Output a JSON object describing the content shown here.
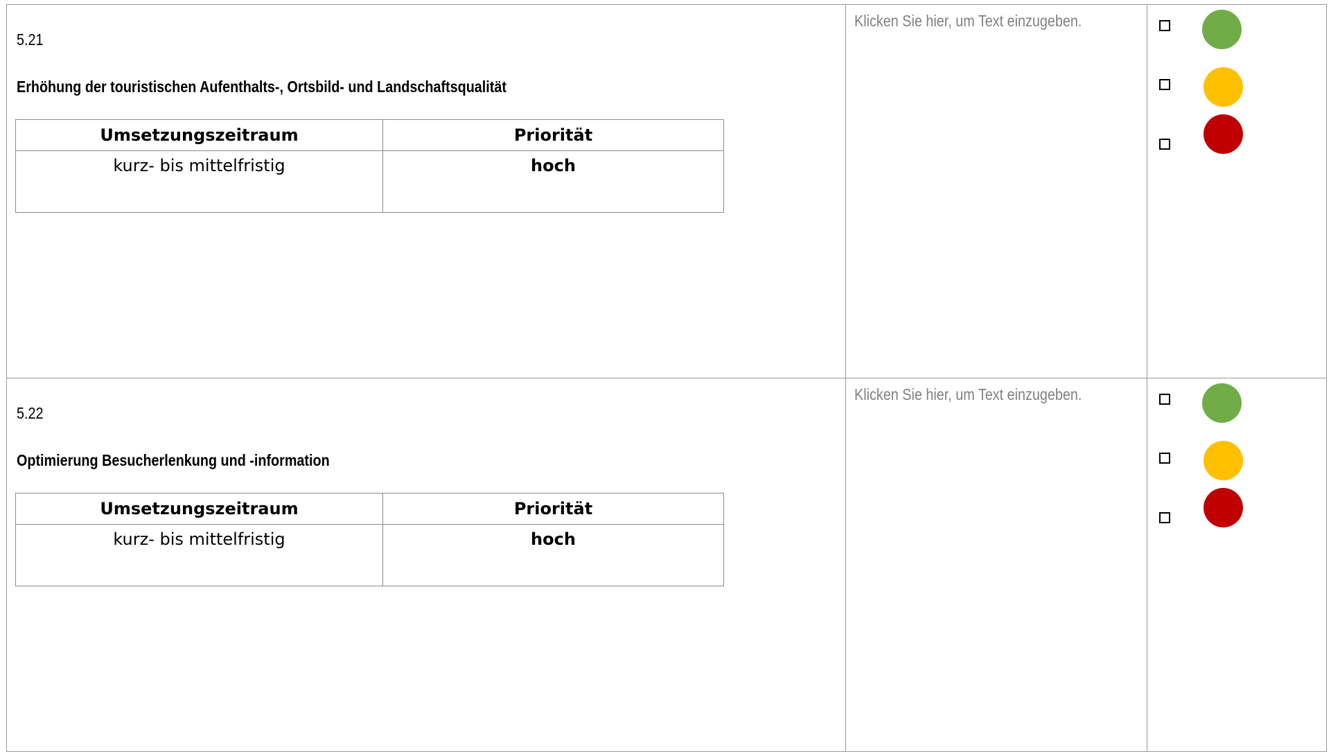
{
  "measures": [
    {
      "id": "5.21",
      "title": "Erhöhung der touristischen Aufenthalts-, Ortsbild- und Landschaftsqualität",
      "table": {
        "headers": [
          "Umsetzungszeitraum",
          "Priorität"
        ],
        "row": [
          "kurz- bis mittelfristig",
          "hoch"
        ]
      },
      "comment_placeholder": "Klicken Sie hier, um Text einzugeben.",
      "status_options": [
        {
          "color": "#70ad47",
          "name": "green",
          "checked": false
        },
        {
          "color": "#ffc000",
          "name": "yellow",
          "checked": false
        },
        {
          "color": "#c00000",
          "name": "red",
          "checked": false
        }
      ]
    },
    {
      "id": "5.22",
      "title": "Optimierung Besucherlenkung und -information",
      "table": {
        "headers": [
          "Umsetzungszeitraum",
          "Priorität"
        ],
        "row": [
          "kurz- bis mittelfristig",
          "hoch"
        ]
      },
      "comment_placeholder": "Klicken Sie hier, um Text einzugeben.",
      "status_options": [
        {
          "color": "#70ad47",
          "name": "green",
          "checked": false
        },
        {
          "color": "#ffc000",
          "name": "yellow",
          "checked": false
        },
        {
          "color": "#c00000",
          "name": "red",
          "checked": false
        }
      ]
    }
  ]
}
